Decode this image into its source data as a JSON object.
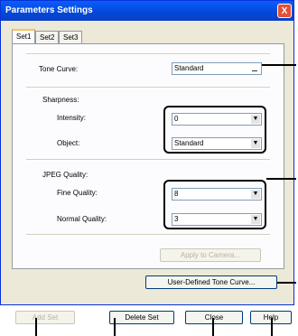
{
  "window": {
    "title": "Parameters Settings",
    "close_glyph": "X"
  },
  "tabs": [
    {
      "label": "Set1",
      "active": true
    },
    {
      "label": "Set2",
      "active": false
    },
    {
      "label": "Set3",
      "active": false
    }
  ],
  "tone_curve": {
    "label": "Tone Curve:",
    "value": "Standard"
  },
  "sharpness": {
    "heading": "Sharpness:",
    "intensity_label": "Intensity:",
    "intensity_value": "0",
    "object_label": "Object:",
    "object_value": "Standard"
  },
  "jpeg_quality": {
    "heading": "JPEG Quality:",
    "fine_label": "Fine Quality:",
    "fine_value": "8",
    "normal_label": "Normal Quality:",
    "normal_value": "3"
  },
  "apply_button": {
    "label": "Apply to Camera..."
  },
  "tone_curve_button": {
    "label": "User-Defined Tone Curve..."
  },
  "footer": {
    "add_set": "Add Set",
    "delete_set": "Delete Set",
    "close": "Close",
    "help": "Help"
  },
  "icons": {
    "dropdown": "▼"
  }
}
